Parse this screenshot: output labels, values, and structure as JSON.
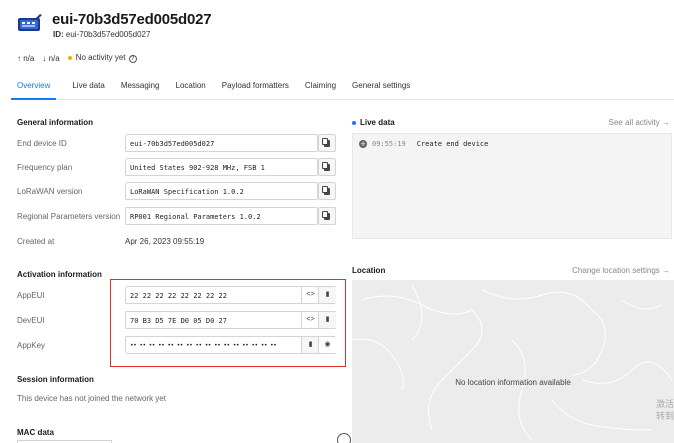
{
  "header": {
    "title": "eui-70b3d57ed005d027",
    "id_label": "ID:",
    "id_value": "eui-70b3d57ed005d027",
    "uplink": "n/a",
    "downlink": "n/a",
    "activity": "No activity yet"
  },
  "tabs": [
    "Overview",
    "Live data",
    "Messaging",
    "Location",
    "Payload formatters",
    "Claiming",
    "General settings"
  ],
  "general": {
    "title": "General information",
    "rows": [
      {
        "label": "End device ID",
        "value": "eui-70b3d57ed005d027"
      },
      {
        "label": "Frequency plan",
        "value": "United States 902-928 MHz, FSB 1"
      },
      {
        "label": "LoRaWAN version",
        "value": "LoRaWAN Specification 1.0.2"
      },
      {
        "label": "Regional Parameters version",
        "value": "RP001 Regional Parameters 1.0.2"
      }
    ],
    "created_label": "Created at",
    "created_value": "Apr 26, 2023 09:55:19"
  },
  "activation": {
    "title": "Activation information",
    "app_eui_label": "AppEUI",
    "app_eui_value": "22 22 22 22 22 22 22 22",
    "dev_eui_label": "DevEUI",
    "dev_eui_value": "70 B3 D5 7E D0 05 D0 27",
    "app_key_label": "AppKey",
    "app_key_value": "•• •• •• •• •• •• •• •• •• •• •• •• •• •• •• ••"
  },
  "session": {
    "title": "Session information",
    "text": "This device has not joined the network yet"
  },
  "mac": {
    "title": "MAC data"
  },
  "live": {
    "title": "Live data",
    "see_all": "See all activity →",
    "entries": [
      {
        "time": "09:55:19",
        "event": "Create end device"
      }
    ]
  },
  "location": {
    "title": "Location",
    "change": "Change location settings →",
    "empty": "No location information available"
  },
  "watermark": {
    "line1": "激活",
    "line2": "转到"
  },
  "colors": {
    "accent": "#1677ff",
    "highlight_border": "#d9322f",
    "activity_dot": "#f1b000"
  }
}
